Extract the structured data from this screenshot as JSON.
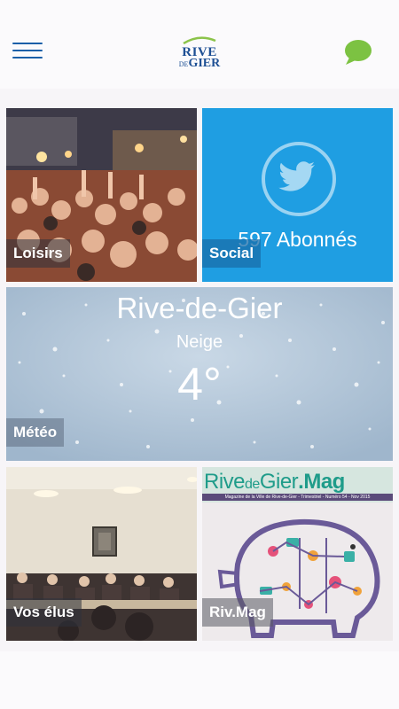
{
  "header": {
    "logo_line1": "RIVE",
    "logo_de": "DE",
    "logo_line2": "GIER",
    "menu_icon": "hamburger-menu-icon",
    "chat_icon": "chat-bubble-icon",
    "colors": {
      "menu": "#1a5fa8",
      "chat": "#7cc242",
      "logo": "#1d4f94"
    }
  },
  "tiles": {
    "loisirs": {
      "label": "Loisirs"
    },
    "social": {
      "label": "Social",
      "count_text": "597 Abonnés",
      "icon": "twitter-bird-icon",
      "color": "#1f9ee2"
    },
    "meteo": {
      "label": "Météo",
      "city": "Rive-de-Gier",
      "condition": "Neige",
      "temperature": "4°"
    },
    "elus": {
      "label": "Vos élus"
    },
    "mag": {
      "label": "Riv.Mag",
      "cover_title_1": "Rive",
      "cover_title_2": "de",
      "cover_title_3": "Gier",
      "cover_title_4": ".Mag",
      "cover_subtitle": "Magazine de la Ville de Rive-de-Gier - Trimestriel - Numéro 54 - Nov 2015"
    }
  }
}
